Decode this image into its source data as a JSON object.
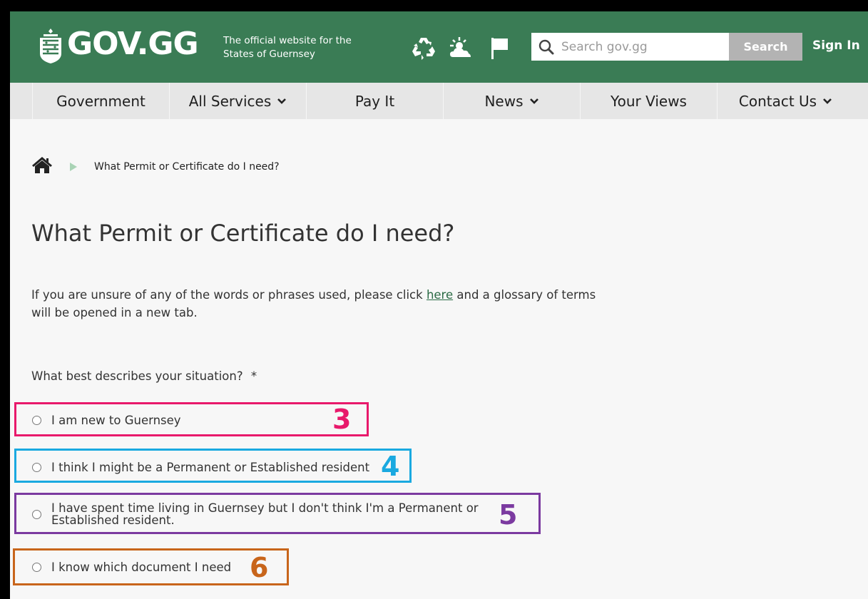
{
  "header": {
    "logo": "GOV.GG",
    "tagline_line1": "The official website for the",
    "tagline_line2": "States of Guernsey",
    "icons": [
      "recycling-icon",
      "weather-icon",
      "flag-icon"
    ],
    "search_placeholder": "Search gov.gg",
    "search_button": "Search",
    "sign_in": "Sign In",
    "brand_color": "#3a7c55"
  },
  "nav": {
    "items": [
      {
        "label": "Government",
        "dropdown": false
      },
      {
        "label": "All Services",
        "dropdown": true
      },
      {
        "label": "Pay It",
        "dropdown": false
      },
      {
        "label": "News",
        "dropdown": true
      },
      {
        "label": "Your Views",
        "dropdown": false
      },
      {
        "label": "Contact Us",
        "dropdown": true
      }
    ]
  },
  "breadcrumb": {
    "current": "What Permit or Certificate do I need?"
  },
  "page": {
    "title": "What Permit or Certificate do I need?",
    "intro_before": "If you are unsure of any of the words or phrases used, please click ",
    "intro_link": "here",
    "intro_after": " and a glossary of terms will be opened in a new tab.",
    "question": "What best describes your situation?",
    "required_mark": "*"
  },
  "options": [
    {
      "label": "I am new to Guernsey",
      "annotation": "3",
      "color": "#e8196b"
    },
    {
      "label": "I think I might be a Permanent or Established resident",
      "annotation": "4",
      "color": "#1aa9e0"
    },
    {
      "label_line1": "I have spent time living in Guernsey but I don't think I'm a Permanent or",
      "label_line2": "Established resident.",
      "annotation": "5",
      "color": "#7b3aa0"
    },
    {
      "label": "I know which document I need",
      "annotation": "6",
      "color": "#c8651b"
    }
  ]
}
